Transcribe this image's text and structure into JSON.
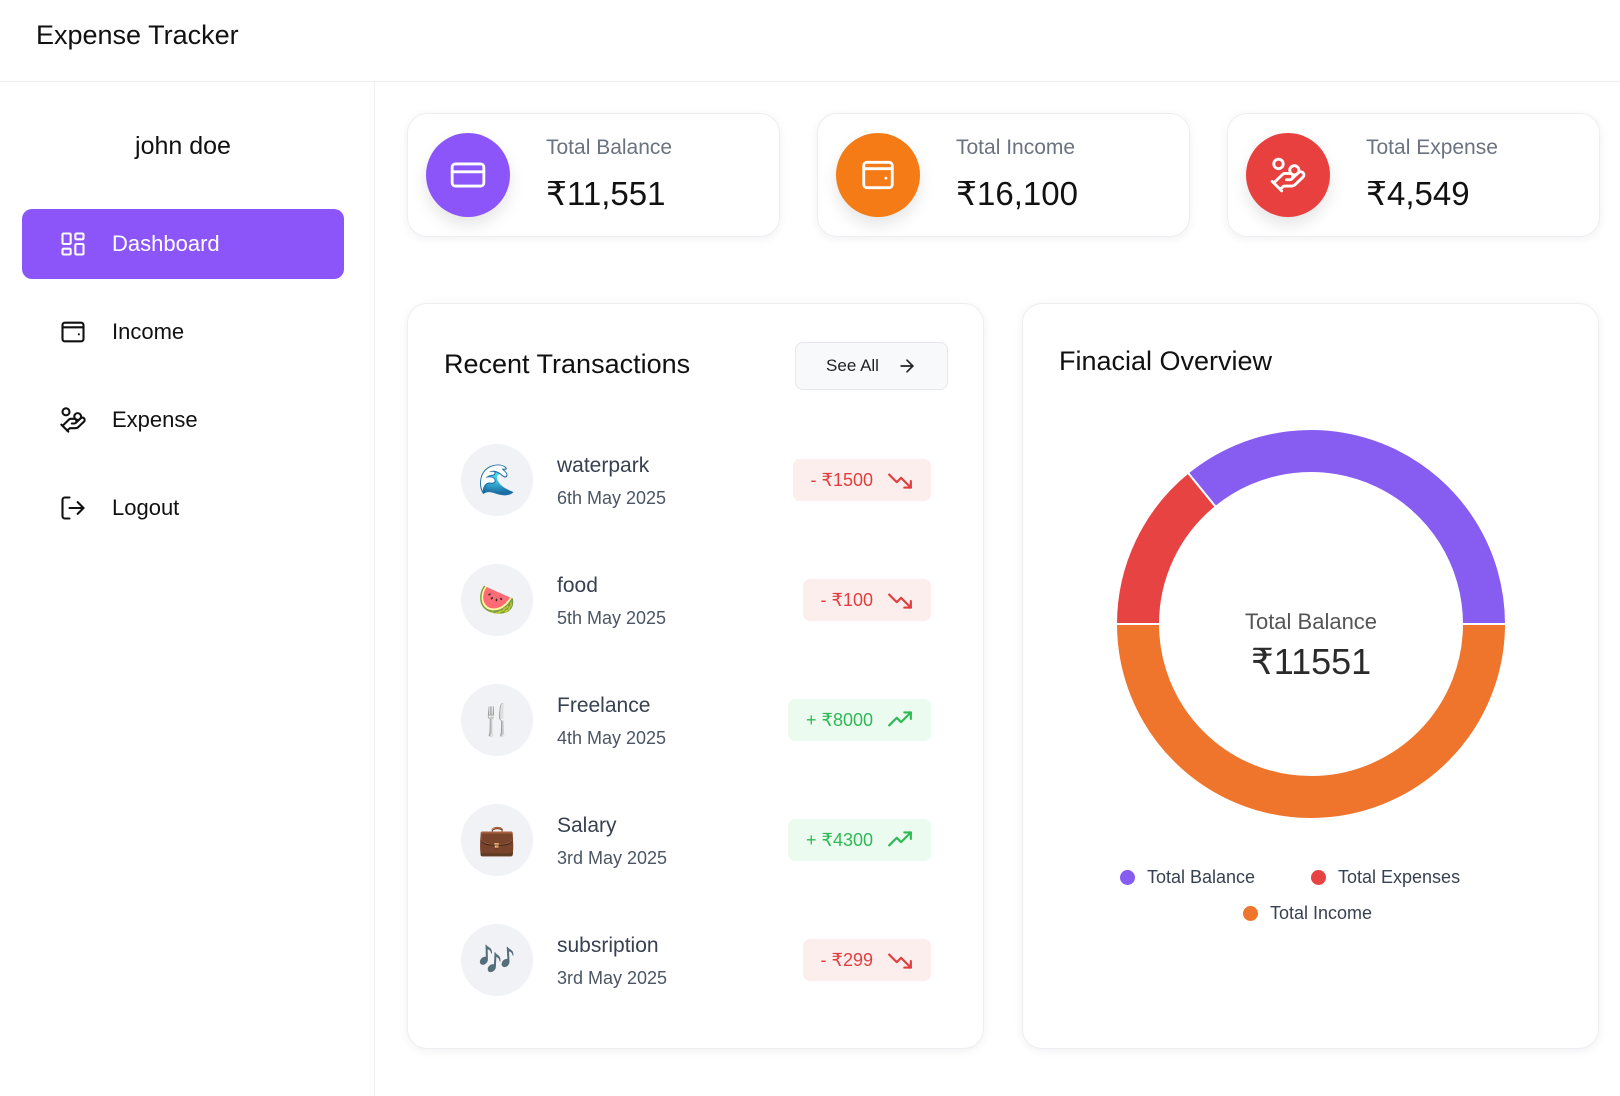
{
  "app": {
    "title": "Expense Tracker"
  },
  "sidebar": {
    "user_name": "john doe",
    "items": [
      {
        "label": "Dashboard",
        "icon": "dashboard-icon",
        "active": true
      },
      {
        "label": "Income",
        "icon": "wallet-icon",
        "active": false
      },
      {
        "label": "Expense",
        "icon": "hand-coins-icon",
        "active": false
      },
      {
        "label": "Logout",
        "icon": "logout-icon",
        "active": false
      }
    ]
  },
  "stats": [
    {
      "label": "Total Balance",
      "value": "₹11,551",
      "color": "#8b55fa",
      "icon": "credit-card-icon"
    },
    {
      "label": "Total Income",
      "value": "₹16,100",
      "color": "#f47b16",
      "icon": "wallet-icon"
    },
    {
      "label": "Total Expense",
      "value": "₹4,549",
      "color": "#e8403f",
      "icon": "hand-coins-icon"
    }
  ],
  "transactions": {
    "title": "Recent Transactions",
    "see_all_label": "See All",
    "items": [
      {
        "name": "waterpark",
        "date": "6th May 2025",
        "amount": "- ₹1500",
        "type": "expense",
        "icon": "🌊"
      },
      {
        "name": "food",
        "date": "5th May 2025",
        "amount": "- ₹100",
        "type": "expense",
        "icon": "🍉"
      },
      {
        "name": "Freelance",
        "date": "4th May 2025",
        "amount": "+ ₹8000",
        "type": "income",
        "icon": "🍴"
      },
      {
        "name": "Salary",
        "date": "3rd May 2025",
        "amount": "+ ₹4300",
        "type": "income",
        "icon": "💼"
      },
      {
        "name": "subsription",
        "date": "3rd May 2025",
        "amount": "- ₹299",
        "type": "expense",
        "icon": "🎶"
      }
    ]
  },
  "overview": {
    "title": "Finacial Overview",
    "center_label": "Total Balance",
    "center_value": "₹11551"
  },
  "chart_data": {
    "type": "pie",
    "title": "",
    "categories": [
      "Total Balance",
      "Total Expenses",
      "Total Income"
    ],
    "values": [
      11551,
      4549,
      16100
    ],
    "colors": [
      "#875cf0",
      "#e84343",
      "#ef752d"
    ],
    "legend": "bottom"
  }
}
